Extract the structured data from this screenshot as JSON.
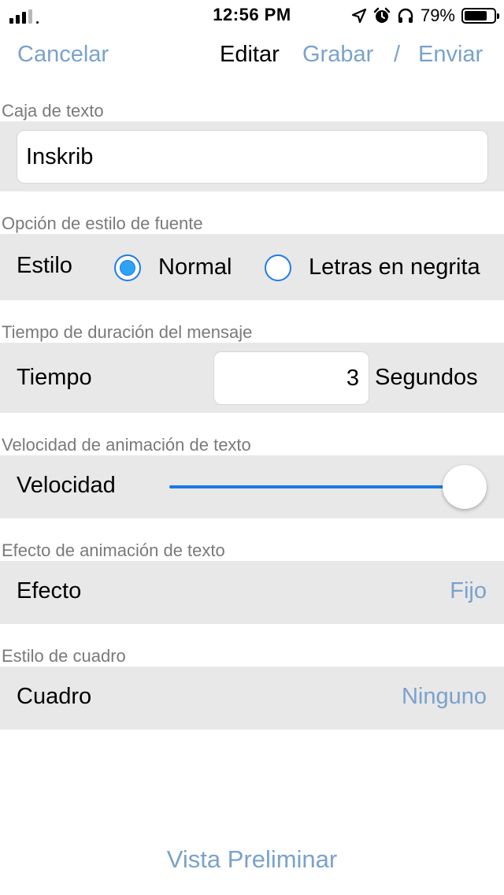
{
  "status_bar": {
    "time": "12:56 PM",
    "battery_percent": "79%",
    "battery_level": 0.79,
    "signal_bars_total": 4,
    "signal_bars_filled": 3,
    "icons": [
      "location-arrow-icon",
      "alarm-icon",
      "headphones-icon",
      "battery-icon"
    ]
  },
  "nav": {
    "cancel": "Cancelar",
    "title": "Editar",
    "record": "Grabar",
    "separator": "/",
    "send": "Enviar"
  },
  "text_box": {
    "header": "Caja de texto",
    "value": "Inskrib"
  },
  "font_style": {
    "header": "Opción de estilo de fuente",
    "label": "Estilo",
    "options": [
      "Normal",
      "Letras en negrita"
    ],
    "selected": "Normal"
  },
  "duration": {
    "header": "Tiempo de duración del mensaje",
    "label": "Tiempo",
    "value": "3",
    "unit": "Segundos"
  },
  "speed": {
    "header": "Velocidad de animación de texto",
    "label": "Velocidad",
    "level": 1.0
  },
  "effect": {
    "header": "Efecto de animación de texto",
    "label": "Efecto",
    "value": "Fijo"
  },
  "frame": {
    "header": "Estilo de cuadro",
    "label": "Cuadro",
    "value": "Ninguno"
  },
  "preview_button": "Vista Preliminar",
  "colors": {
    "accent_link": "#7aa2cb",
    "control_blue": "#1e7be8",
    "band_gray": "#e8e8e8",
    "header_gray": "#7a7a7a"
  }
}
